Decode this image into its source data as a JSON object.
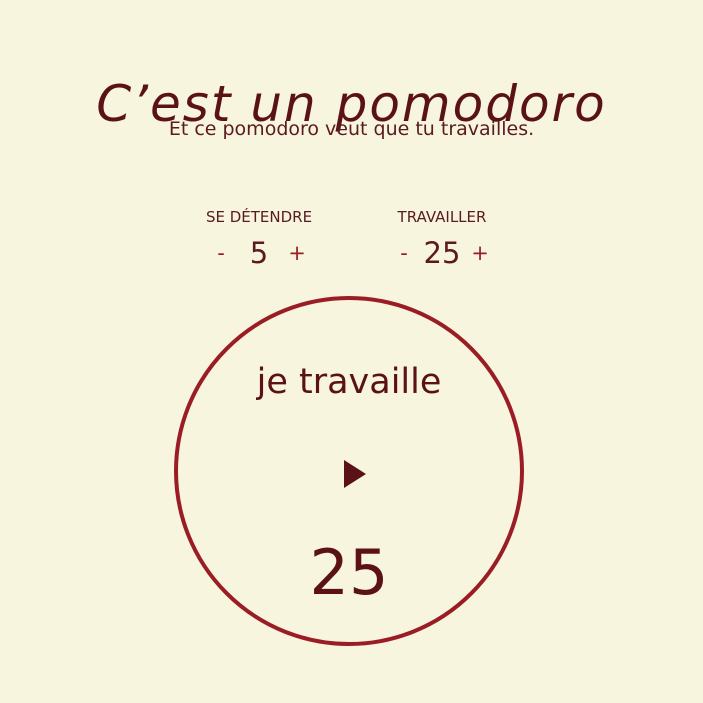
{
  "header": {
    "title": "C’est un pomodoro",
    "subtitle": "Et ce pomodoro veut que tu travailles."
  },
  "controls": {
    "break": {
      "label": "SE DÉTENDRE",
      "decrement": "-",
      "value": "5",
      "increment": "+"
    },
    "work": {
      "label": "TRAVAILLER",
      "decrement": "-",
      "value": "25",
      "increment": "+"
    }
  },
  "timer": {
    "status": "je travaille",
    "play_icon": "play-icon",
    "count": "25"
  },
  "colors": {
    "background": "#f7f5dd",
    "text": "#5a1a1f",
    "accent": "#9a1d25"
  }
}
